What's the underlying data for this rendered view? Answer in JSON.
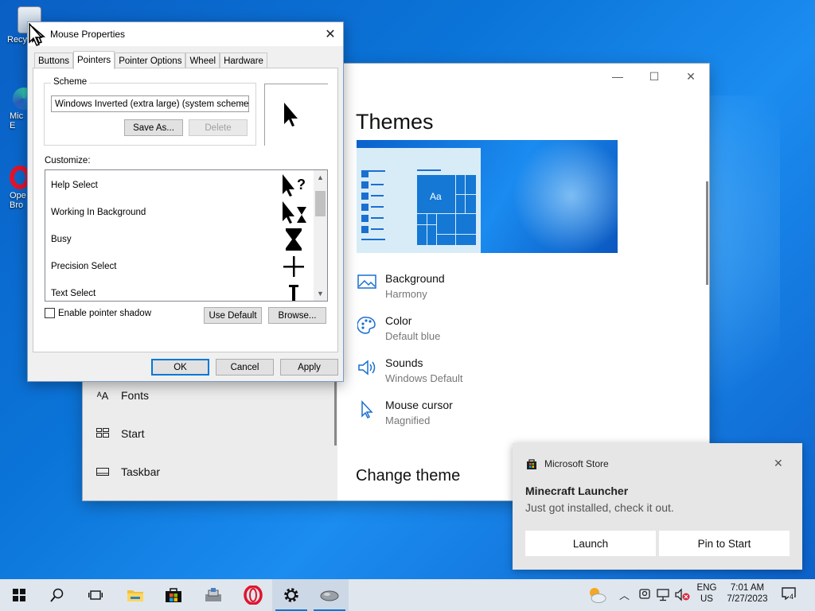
{
  "desktop": {
    "icons": [
      {
        "label": "Recy",
        "icon": "recycle-bin-icon"
      },
      {
        "label": "Mic\nE",
        "icon": "edge-icon"
      },
      {
        "label": "Ope\nBro",
        "icon": "opera-icon"
      }
    ]
  },
  "settings": {
    "nav": {
      "items": [
        {
          "label": "Fonts",
          "icon": "fonts-icon"
        },
        {
          "label": "Start",
          "icon": "start-icon"
        },
        {
          "label": "Taskbar",
          "icon": "taskbar-icon"
        }
      ]
    },
    "caption": {
      "minimize": "—",
      "maximize": "☐",
      "close": "✕"
    },
    "themes_title": "Themes",
    "preview_aa": "Aa",
    "properties": [
      {
        "title": "Background",
        "value": "Harmony",
        "icon": "picture-icon"
      },
      {
        "title": "Color",
        "value": "Default blue",
        "icon": "palette-icon"
      },
      {
        "title": "Sounds",
        "value": "Windows Default",
        "icon": "speaker-icon"
      },
      {
        "title": "Mouse cursor",
        "value": "Magnified",
        "icon": "cursor-icon"
      }
    ],
    "change_theme": "Change theme"
  },
  "dialog": {
    "title": "Mouse Properties",
    "tabs": [
      "Buttons",
      "Pointers",
      "Pointer Options",
      "Wheel",
      "Hardware"
    ],
    "active_tab": "Pointers",
    "scheme_label": "Scheme",
    "scheme_value": "Windows Inverted (extra large) (system scheme)",
    "save_as": "Save As...",
    "delete": "Delete",
    "customize_label": "Customize:",
    "pointers": [
      {
        "label": "Help Select",
        "icon": "help-select-cursor-icon"
      },
      {
        "label": "Working In Background",
        "icon": "working-cursor-icon"
      },
      {
        "label": "Busy",
        "icon": "hourglass-cursor-icon"
      },
      {
        "label": "Precision Select",
        "icon": "crosshair-cursor-icon"
      },
      {
        "label": "Text Select",
        "icon": "text-cursor-icon"
      }
    ],
    "enable_shadow": "Enable pointer shadow",
    "shadow_checked": false,
    "use_default": "Use Default",
    "browse": "Browse...",
    "ok": "OK",
    "cancel": "Cancel",
    "apply": "Apply"
  },
  "toast": {
    "app": "Microsoft Store",
    "title": "Minecraft Launcher",
    "body": "Just got installed, check it out.",
    "launch": "Launch",
    "pin": "Pin to Start"
  },
  "taskbar": {
    "language": "ENG",
    "region": "US",
    "time": "7:01 AM",
    "date": "7/27/2023",
    "notification_count": "4"
  }
}
